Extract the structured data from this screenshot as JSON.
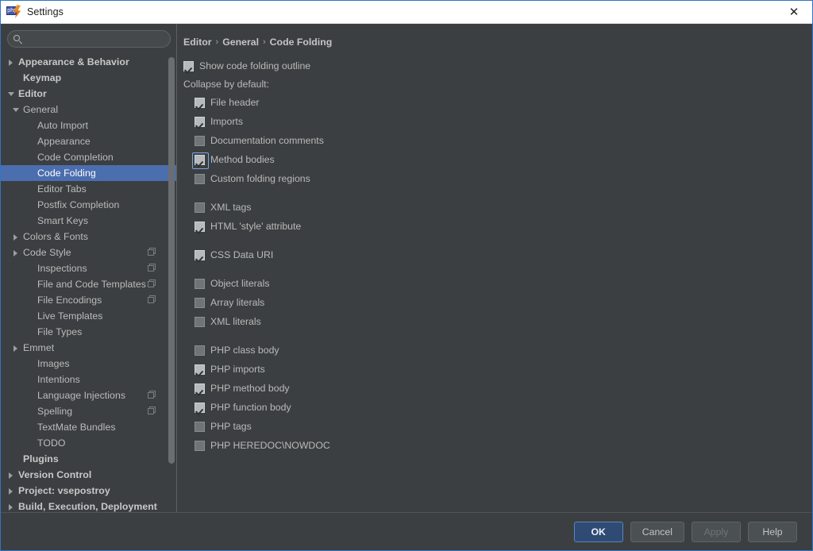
{
  "window": {
    "title": "Settings",
    "app_icon": "phpstorm-icon",
    "close_icon": "close-icon",
    "accent_border": "#2f75c4"
  },
  "search": {
    "value": "",
    "placeholder": "",
    "icon": "search-icon"
  },
  "sidebar": {
    "scope_icon": "copy-scope-icon",
    "items": [
      {
        "label": "Appearance & Behavior",
        "depth": 0,
        "arrow": "right",
        "bold": true,
        "selected": false,
        "scope": false
      },
      {
        "label": "Keymap",
        "depth": 1,
        "arrow": "none",
        "bold": true,
        "selected": false,
        "scope": false
      },
      {
        "label": "Editor",
        "depth": 0,
        "arrow": "down",
        "bold": true,
        "selected": false,
        "scope": false
      },
      {
        "label": "General",
        "depth": 1,
        "arrow": "down",
        "bold": false,
        "selected": false,
        "scope": false
      },
      {
        "label": "Auto Import",
        "depth": 3,
        "arrow": "none",
        "bold": false,
        "selected": false,
        "scope": false
      },
      {
        "label": "Appearance",
        "depth": 3,
        "arrow": "none",
        "bold": false,
        "selected": false,
        "scope": false
      },
      {
        "label": "Code Completion",
        "depth": 3,
        "arrow": "none",
        "bold": false,
        "selected": false,
        "scope": false
      },
      {
        "label": "Code Folding",
        "depth": 3,
        "arrow": "none",
        "bold": false,
        "selected": true,
        "scope": false
      },
      {
        "label": "Editor Tabs",
        "depth": 3,
        "arrow": "none",
        "bold": false,
        "selected": false,
        "scope": false
      },
      {
        "label": "Postfix Completion",
        "depth": 3,
        "arrow": "none",
        "bold": false,
        "selected": false,
        "scope": false
      },
      {
        "label": "Smart Keys",
        "depth": 3,
        "arrow": "none",
        "bold": false,
        "selected": false,
        "scope": false
      },
      {
        "label": "Colors & Fonts",
        "depth": 1,
        "arrow": "right",
        "bold": false,
        "selected": false,
        "scope": false
      },
      {
        "label": "Code Style",
        "depth": 1,
        "arrow": "right",
        "bold": false,
        "selected": false,
        "scope": true
      },
      {
        "label": "Inspections",
        "depth": 2,
        "arrow": "none",
        "bold": false,
        "selected": false,
        "scope": true
      },
      {
        "label": "File and Code Templates",
        "depth": 2,
        "arrow": "none",
        "bold": false,
        "selected": false,
        "scope": true
      },
      {
        "label": "File Encodings",
        "depth": 2,
        "arrow": "none",
        "bold": false,
        "selected": false,
        "scope": true
      },
      {
        "label": "Live Templates",
        "depth": 2,
        "arrow": "none",
        "bold": false,
        "selected": false,
        "scope": false
      },
      {
        "label": "File Types",
        "depth": 2,
        "arrow": "none",
        "bold": false,
        "selected": false,
        "scope": false
      },
      {
        "label": "Emmet",
        "depth": 1,
        "arrow": "right",
        "bold": false,
        "selected": false,
        "scope": false
      },
      {
        "label": "Images",
        "depth": 2,
        "arrow": "none",
        "bold": false,
        "selected": false,
        "scope": false
      },
      {
        "label": "Intentions",
        "depth": 2,
        "arrow": "none",
        "bold": false,
        "selected": false,
        "scope": false
      },
      {
        "label": "Language Injections",
        "depth": 2,
        "arrow": "none",
        "bold": false,
        "selected": false,
        "scope": true
      },
      {
        "label": "Spelling",
        "depth": 2,
        "arrow": "none",
        "bold": false,
        "selected": false,
        "scope": true
      },
      {
        "label": "TextMate Bundles",
        "depth": 2,
        "arrow": "none",
        "bold": false,
        "selected": false,
        "scope": false
      },
      {
        "label": "TODO",
        "depth": 2,
        "arrow": "none",
        "bold": false,
        "selected": false,
        "scope": false
      },
      {
        "label": "Plugins",
        "depth": 1,
        "arrow": "none",
        "bold": true,
        "selected": false,
        "scope": false
      },
      {
        "label": "Version Control",
        "depth": 0,
        "arrow": "right",
        "bold": true,
        "selected": false,
        "scope": false
      },
      {
        "label": "Project: vsepostroy",
        "depth": 0,
        "arrow": "right",
        "bold": true,
        "selected": false,
        "scope": false
      },
      {
        "label": "Build, Execution, Deployment",
        "depth": 0,
        "arrow": "right",
        "bold": true,
        "selected": false,
        "scope": false
      }
    ]
  },
  "breadcrumb": {
    "items": [
      "Editor",
      "General",
      "Code Folding"
    ],
    "separator": "›"
  },
  "main": {
    "show_outline": {
      "label": "Show code folding outline",
      "checked": true
    },
    "collapse_label": "Collapse by default:",
    "groups": [
      {
        "items": [
          {
            "label": "File header",
            "checked": true,
            "focused": false
          },
          {
            "label": "Imports",
            "checked": true,
            "focused": false
          },
          {
            "label": "Documentation comments",
            "checked": false,
            "focused": false
          },
          {
            "label": "Method bodies",
            "checked": true,
            "focused": true
          },
          {
            "label": "Custom folding regions",
            "checked": false,
            "focused": false
          }
        ]
      },
      {
        "items": [
          {
            "label": "XML tags",
            "checked": false,
            "focused": false
          },
          {
            "label": "HTML 'style' attribute",
            "checked": true,
            "focused": false
          }
        ]
      },
      {
        "items": [
          {
            "label": "CSS Data URI",
            "checked": true,
            "focused": false
          }
        ]
      },
      {
        "items": [
          {
            "label": "Object literals",
            "checked": false,
            "focused": false
          },
          {
            "label": "Array literals",
            "checked": false,
            "focused": false
          },
          {
            "label": "XML literals",
            "checked": false,
            "focused": false
          }
        ]
      },
      {
        "items": [
          {
            "label": "PHP class body",
            "checked": false,
            "focused": false
          },
          {
            "label": "PHP imports",
            "checked": true,
            "focused": false
          },
          {
            "label": "PHP method body",
            "checked": true,
            "focused": false
          },
          {
            "label": "PHP function body",
            "checked": true,
            "focused": false
          },
          {
            "label": "PHP tags",
            "checked": false,
            "focused": false
          },
          {
            "label": "PHP HEREDOC\\NOWDOC",
            "checked": false,
            "focused": false
          }
        ]
      }
    ]
  },
  "footer": {
    "buttons": [
      {
        "label": "OK",
        "style": "primary",
        "disabled": false
      },
      {
        "label": "Cancel",
        "style": "normal",
        "disabled": false
      },
      {
        "label": "Apply",
        "style": "normal",
        "disabled": true
      },
      {
        "label": "Help",
        "style": "normal",
        "disabled": false
      }
    ]
  }
}
